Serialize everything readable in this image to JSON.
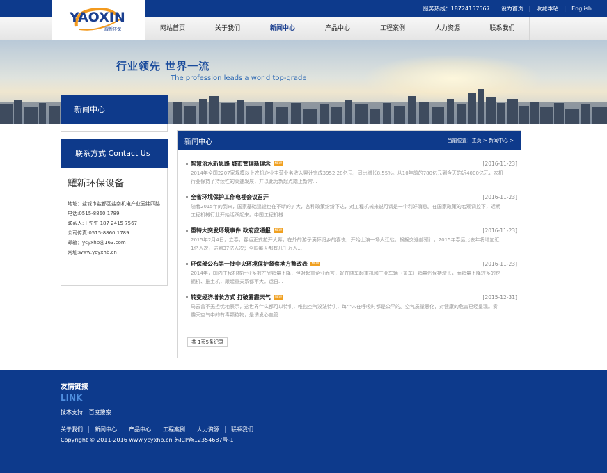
{
  "topbar": {
    "hotline": "服务热线：18724157567",
    "set_home": "设为首页",
    "favorite": "收藏本站",
    "english": "English"
  },
  "logo": {
    "text": "YAOXIN",
    "sub": "耀新环保"
  },
  "nav": [
    {
      "label": "网站首页"
    },
    {
      "label": "关于我们"
    },
    {
      "label": "新闻中心"
    },
    {
      "label": "产品中心"
    },
    {
      "label": "工程案例"
    },
    {
      "label": "人力资源"
    },
    {
      "label": "联系我们"
    }
  ],
  "banner": {
    "slogan": "行业领先  世界一流",
    "slogan_en": "The profession leads a world top-grade"
  },
  "sidebar": {
    "title": "新闻中心",
    "contact_title": "联系方式  Contact Us",
    "company": "耀新环保设备",
    "address": "地址：盐城市盐都区盐南机电产业园纬四路",
    "phone": "电话:0515-8860 1789",
    "contact_person": "联系人:王先生 187 2415 7567",
    "fax": "公司传真:0515-8860 1789",
    "email": "邮箱：ycyxhb@163.com",
    "website": "网址:www.ycyxhb.cn"
  },
  "main": {
    "title": "新闻中心",
    "breadcrumb": "当前位置：主页 > 新闻中心 >",
    "new_badge": "NEW",
    "news": [
      {
        "title": "智慧治水新思路 城市管理新理念",
        "date": "[2016-11-23]",
        "desc1": "2014年全国2207家规模以上农机企业主营业务收入累计完成3952.28亿元，同比增长8.55%。从10年前的780亿元到今天的近4000亿元，农机",
        "desc2": "行业保持了持续性的高速发展，并以此为新起点踏上新常..."
      },
      {
        "title": "全省环境保护工作电视会议召开",
        "date": "[2016-11-23]",
        "desc1": "随着2015年的到来，国家基础建设也在不断的扩大，各种政策纷纷下达，对工程机械来说可谓是一个利好消息。在国家政策的宏观调控下，近期",
        "desc2": "工程机械行业开始活跃起来。中国工程机械..."
      },
      {
        "title": "重特大突发环境事件 政府应通报",
        "date": "[2016-11-23]",
        "desc1": "2015年2月4日，立春，春运正式拉开大幕，在外的游子满怀归乡的喜悦，开始上演一场大迁徙。根据交通部预计，2015年春运比去年将增加近",
        "desc2": "1亿人次，达到37亿人次；全国每天都有几千万人..."
      },
      {
        "title": "环保部公布第一批中央环境保护督察地方整改表",
        "date": "[2016-11-23]",
        "desc1": "2014年，国内工程机械行业多数产品销量下降，但对起重企业而言，好在随车起重机和工业车辆（叉车）销量仍保持增长，而销量下降较多的挖",
        "desc2": "掘机、推土机，跟起重关系都不大。运日..."
      },
      {
        "title": "转变经济增长方式 打破雾霾天气",
        "date": "[2015-12-31]",
        "desc1": "马云曾不无担忧地表示，这世界什么都可以特供，唯独空气没法特供，每个人在呼吸时都是公平的。空气质量恶化，对健康的危害已经呈现。雾",
        "desc2": "霾天空气中的有毒颗粒物，是诱发心血管..."
      }
    ],
    "pager": "共 1页5条记录"
  },
  "footer": {
    "friend_title": "友情链接",
    "friend_link": "LINK",
    "friends": [
      "技术支持",
      "百度搜索"
    ],
    "nav": [
      "关于我们",
      "新闻中心",
      "产品中心",
      "工程案例",
      "人力资源",
      "联系我们"
    ],
    "copyright": "Copyright © 2011-2016 www.ycyxhb.cn 苏ICP备12354687号-1"
  },
  "colors": {
    "brand": "#0e3a8b",
    "badge": "#f0a020"
  }
}
